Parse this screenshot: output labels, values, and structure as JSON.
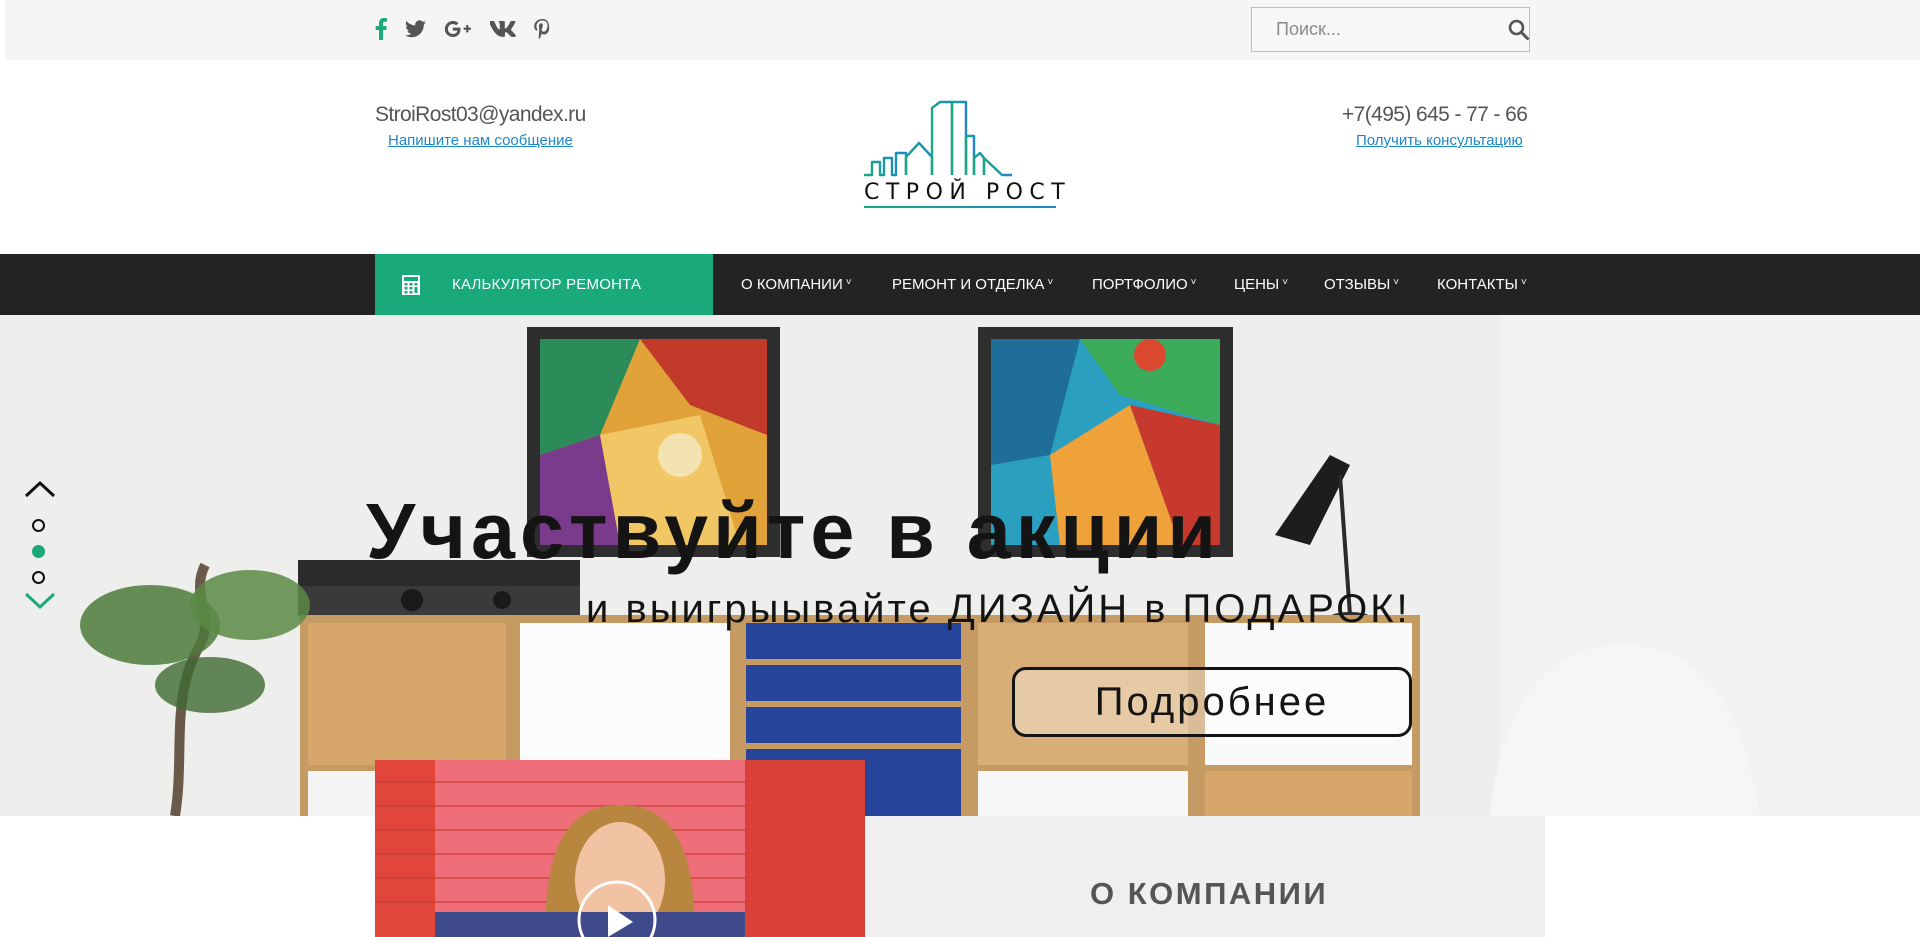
{
  "topbar": {
    "socials": [
      {
        "icon": "facebook-icon",
        "color": "#19a97b"
      },
      {
        "icon": "twitter-icon",
        "color": "#555555"
      },
      {
        "icon": "google-plus-icon",
        "color": "#555555"
      },
      {
        "icon": "vk-icon",
        "color": "#555555"
      },
      {
        "icon": "pinterest-icon",
        "color": "#555555"
      }
    ],
    "search": {
      "placeholder": "Поиск...",
      "icon": "search-icon"
    }
  },
  "header": {
    "email": "StroiRost03@yandex.ru",
    "email_link": "Напишите нам сообщение",
    "logo_text": "СТРОЙ РОСТ",
    "phone": "+7(495) 645 - 77 - 66",
    "phone_link": "Получить консультацию"
  },
  "nav": {
    "calculator": {
      "label": "КАЛЬКУЛЯТОР РЕМОНТА",
      "icon": "calculator-icon"
    },
    "items": [
      {
        "label": "О КОМПАНИИ"
      },
      {
        "label": "РЕМОНТ И ОТДЕЛКА"
      },
      {
        "label": "ПОРТФОЛИО"
      },
      {
        "label": "ЦЕНЫ"
      },
      {
        "label": "ОТЗЫВЫ"
      },
      {
        "label": "КОНТАКТЫ"
      }
    ],
    "caret": "˅"
  },
  "hero": {
    "title": "Участвуйте в акции",
    "subtitle": "и выигрыывайте ДИЗАЙН в ПОДАРОК!",
    "button": "Подробнее",
    "slides_total": 3,
    "active_slide": 2
  },
  "about": {
    "title": "О КОМПАНИИ"
  },
  "colors": {
    "accent": "#19a97b",
    "nav_bg": "#232323",
    "link": "#1c87c9",
    "topbar_bg": "#f5f5f5"
  }
}
